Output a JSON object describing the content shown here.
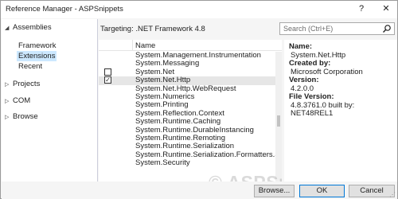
{
  "window": {
    "title": "Reference Manager - ASPSnippets",
    "help_label": "?",
    "close_label": "✕"
  },
  "sidebar": {
    "assemblies": {
      "caret": "◢",
      "label": "Assemblies"
    },
    "sub_items": [
      {
        "label": "Framework",
        "selected": false
      },
      {
        "label": "Extensions",
        "selected": true
      },
      {
        "label": "Recent",
        "selected": false
      }
    ],
    "nodes": [
      {
        "caret": "▷",
        "label": "Projects"
      },
      {
        "caret": "▷",
        "label": "COM"
      },
      {
        "caret": "▷",
        "label": "Browse"
      }
    ]
  },
  "toolbar": {
    "targeting": "Targeting: .NET Framework 4.8",
    "search_placeholder": "Search (Ctrl+E)"
  },
  "list": {
    "column_name": "Name",
    "rows": [
      {
        "name": "System.Management.Instrumentation",
        "checkbox": false,
        "checked": false,
        "highlighted": false
      },
      {
        "name": "System.Messaging",
        "checkbox": false,
        "checked": false,
        "highlighted": false
      },
      {
        "name": "System.Net",
        "checkbox": true,
        "checked": false,
        "highlighted": false
      },
      {
        "name": "System.Net.Http",
        "checkbox": true,
        "checked": true,
        "highlighted": true
      },
      {
        "name": "System.Net.Http.WebRequest",
        "checkbox": false,
        "checked": false,
        "highlighted": false
      },
      {
        "name": "System.Numerics",
        "checkbox": false,
        "checked": false,
        "highlighted": false
      },
      {
        "name": "System.Printing",
        "checkbox": false,
        "checked": false,
        "highlighted": false
      },
      {
        "name": "System.Reflection.Context",
        "checkbox": false,
        "checked": false,
        "highlighted": false
      },
      {
        "name": "System.Runtime.Caching",
        "checkbox": false,
        "checked": false,
        "highlighted": false
      },
      {
        "name": "System.Runtime.DurableInstancing",
        "checkbox": false,
        "checked": false,
        "highlighted": false
      },
      {
        "name": "System.Runtime.Remoting",
        "checkbox": false,
        "checked": false,
        "highlighted": false
      },
      {
        "name": "System.Runtime.Serialization",
        "checkbox": false,
        "checked": false,
        "highlighted": false
      },
      {
        "name": "System.Runtime.Serialization.Formatters.S...",
        "checkbox": false,
        "checked": false,
        "highlighted": false
      },
      {
        "name": "System.Security",
        "checkbox": false,
        "checked": false,
        "highlighted": false
      }
    ]
  },
  "info": {
    "name_label": "Name:",
    "name_value": "System.Net.Http",
    "created_by_label": "Created by:",
    "created_by_value": "Microsoft Corporation",
    "version_label": "Version:",
    "version_value": "4.2.0.0",
    "file_version_label": "File Version:",
    "file_version_value": "4.8.3761.0 built by: NET48REL1"
  },
  "watermark": "© ASPSnippets.com",
  "footer": {
    "browse_label": "Browse...",
    "ok_label": "OK",
    "cancel_label": "Cancel"
  },
  "colors": {
    "selection": "#cce8ff",
    "ok_border": "#0078d7"
  }
}
